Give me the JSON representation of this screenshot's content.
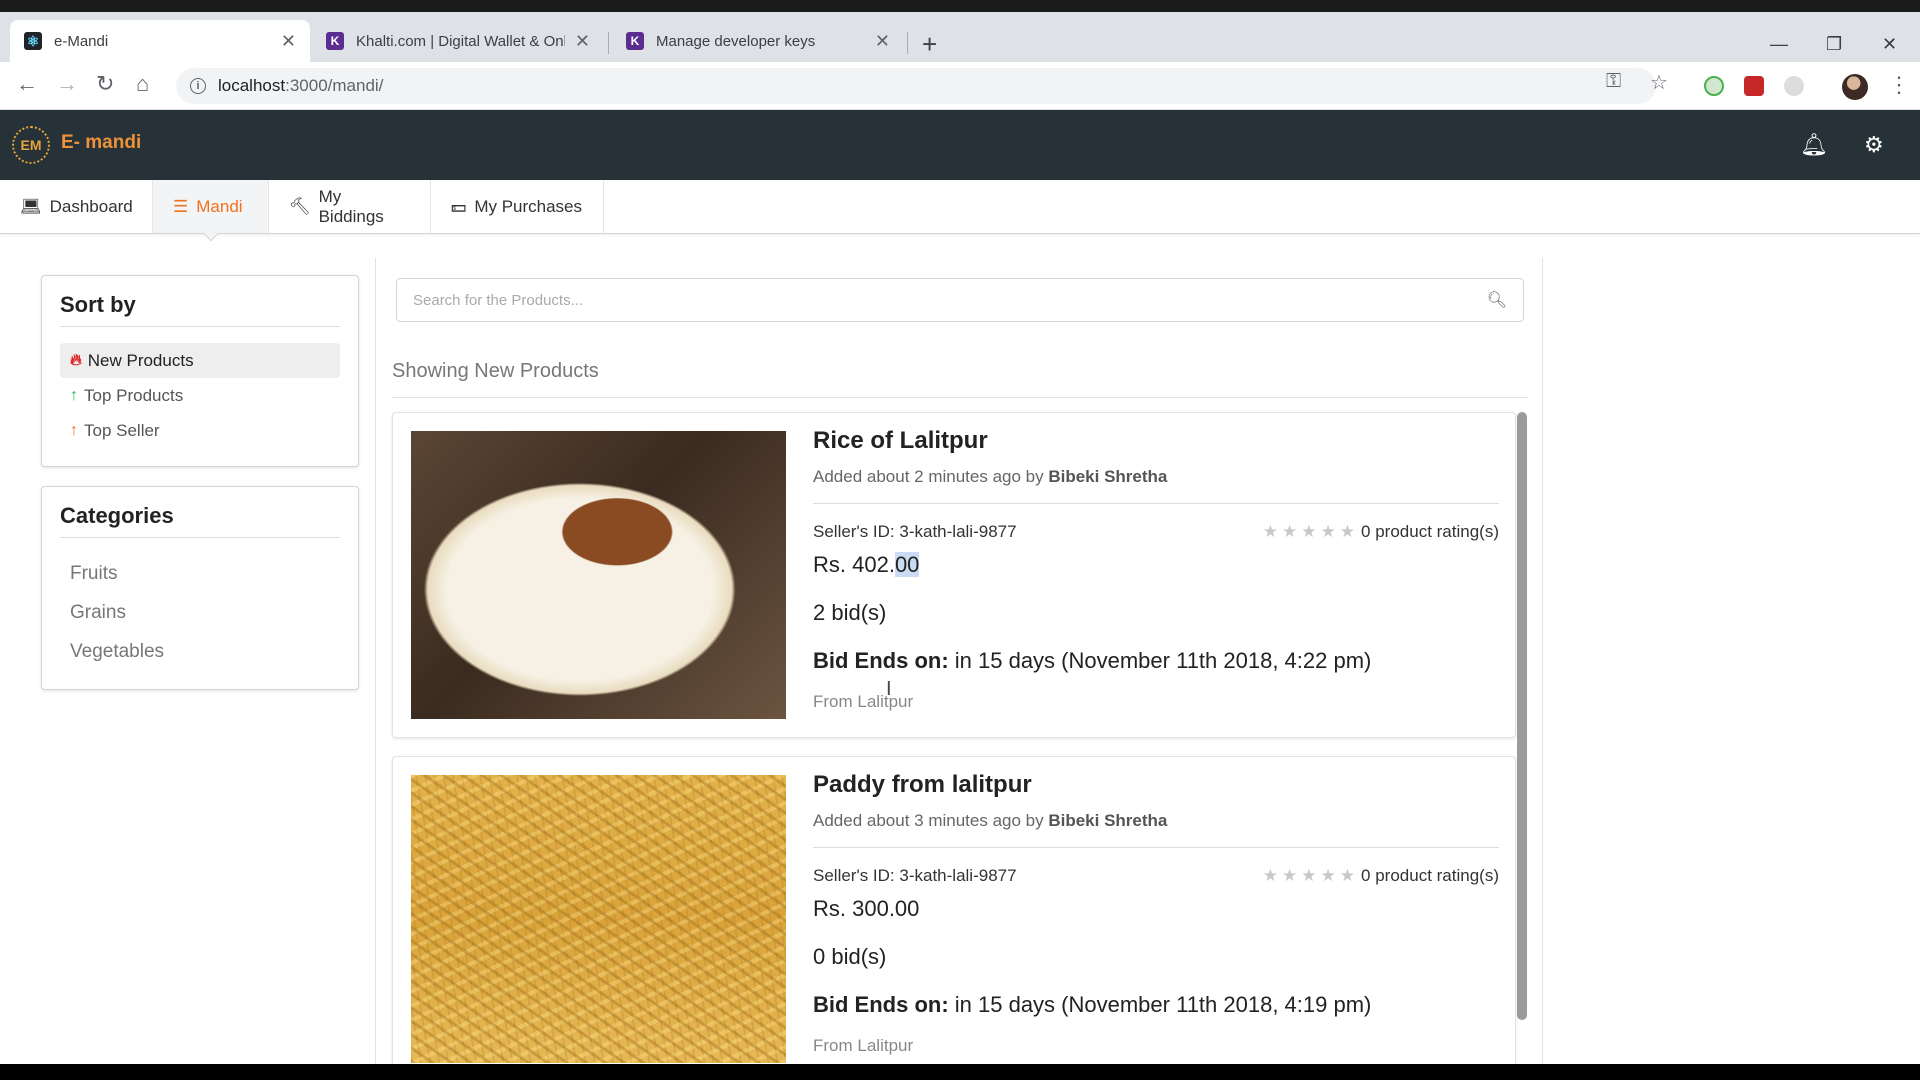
{
  "browser": {
    "tabs": [
      {
        "title": "e-Mandi",
        "favicon": "react-icon"
      },
      {
        "title": "Khalti.com | Digital Wallet & Onli",
        "favicon": "khalti-icon"
      },
      {
        "title": "Manage developer keys",
        "favicon": "khalti-icon"
      }
    ],
    "url_host": "localhost",
    "url_path": ":3000/mandi/"
  },
  "app": {
    "logo_badge": "EM",
    "logo_text": "E- mandi",
    "nav": [
      {
        "label": "Dashboard",
        "icon": "laptop-icon"
      },
      {
        "label": "Mandi",
        "icon": "list-icon",
        "active": true
      },
      {
        "label": "My Biddings",
        "icon": "gavel-icon"
      },
      {
        "label": "My Purchases",
        "icon": "money-icon"
      }
    ],
    "accent_color": "#f2711c",
    "header_color": "#263238"
  },
  "sidebar": {
    "sort_title": "Sort by",
    "sort_items": [
      {
        "label": "New Products",
        "icon": "fire-icon",
        "color": "#db2828",
        "active": true
      },
      {
        "label": "Top Products",
        "icon": "arrow-up-icon",
        "color": "#21ba45"
      },
      {
        "label": "Top Seller",
        "icon": "arrow-up-icon",
        "color": "#f2711c"
      }
    ],
    "categories_title": "Categories",
    "categories": [
      "Fruits",
      "Grains",
      "Vegetables"
    ]
  },
  "main": {
    "search_placeholder": "Search for the Products...",
    "showing_label": "Showing New Products",
    "products": [
      {
        "title": "Rice of Lalitpur",
        "added": "Added about 2 minutes ago by ",
        "seller_name": "Bibeki Shretha",
        "seller_id": "Seller's ID: 3-kath-lali-9877",
        "rating": 0,
        "rating_text": "0 product rating(s)",
        "price_main": "Rs. 402.",
        "price_decimal": "00",
        "bids": "2 bid(s)",
        "ends_label": "Bid Ends on:",
        "ends_value": " in 15 days (November 11th 2018, 4:22 pm)",
        "from": "From Lalitpur"
      },
      {
        "title": "Paddy from lalitpur",
        "added": "Added about 3 minutes ago by ",
        "seller_name": "Bibeki Shretha",
        "seller_id": "Seller's ID: 3-kath-lali-9877",
        "rating": 0,
        "rating_text": "0 product rating(s)",
        "price_main": "Rs. 300.00",
        "price_decimal": "",
        "bids": "0 bid(s)",
        "ends_label": "Bid Ends on:",
        "ends_value": " in 15 days (November 11th 2018, 4:19 pm)",
        "from": "From Lalitpur"
      }
    ]
  }
}
